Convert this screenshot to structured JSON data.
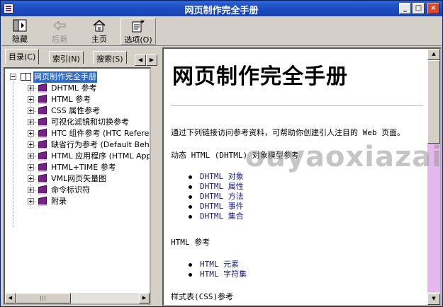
{
  "window": {
    "title": "网页制作完全手册",
    "controls": {
      "minimize": "_",
      "maximize": "□",
      "close": "×"
    }
  },
  "toolbar": {
    "hide_label": "隐藏",
    "back_label": "后退",
    "home_label": "主页",
    "options_label": "选项(O)"
  },
  "left_tabs": {
    "contents_label": "目录(C)",
    "index_label": "索引(N)",
    "search_label": "搜索(S)"
  },
  "tree": {
    "root": "网页制作完全手册",
    "items": [
      "DHTML 参考",
      "HTML 参考",
      "CSS 属性参考",
      "可视化滤镜和切换参考",
      "HTC 组件参考 (HTC Reference)",
      "缺省行为参考 (Default Behaviors)",
      "HTML 应用程序 (HTML Applications)",
      "HTML+TIME 参考",
      "VML网页矢量图",
      "命令标识符",
      "附录"
    ]
  },
  "content": {
    "heading": "网页制作完全手册",
    "intro": "通过下列链接访问参考资料，可帮助你创建引人注目的 Web 页面。",
    "section1_title": "动态 HTML (DHTML) 对象模型参考",
    "section1_links": [
      "DHTML 对象",
      "DHTML 属性",
      "DHTML 方法",
      "DHTML 事件",
      "DHTML 集合"
    ],
    "section2_title": "HTML 参考",
    "section2_links": [
      "HTML 元素",
      "HTML 字符集"
    ],
    "section3_title": "样式表(CSS)参考"
  },
  "watermark": "ouyaoxiazai",
  "colors": {
    "titlebar": "#1a49c0",
    "selection": "#316ac5",
    "book": "#7a1f8a",
    "scroll_track": "#e4b8ec"
  }
}
